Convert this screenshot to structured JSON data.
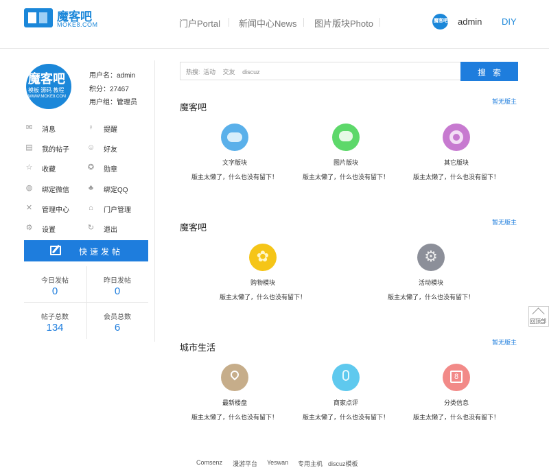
{
  "header": {
    "logo_cn": "魔客吧",
    "logo_en": "MOKE8.COM",
    "nav": [
      "门户Portal",
      "新闻中心News",
      "图片版块Photo"
    ],
    "avatar_text": "魔客吧",
    "username": "admin",
    "diy": "DIY"
  },
  "profile": {
    "avatar_title": "魔客吧",
    "avatar_sub": "模板 源码 教程",
    "avatar_url": "WWW.MOKE8.COM",
    "username_line": "用户名：admin",
    "points_line": "积分：27467",
    "group_line": "用户组：管理员"
  },
  "menu": [
    {
      "label": "消息",
      "icon": "mail-icon",
      "glyph": "✉"
    },
    {
      "label": "提醒",
      "icon": "bulb-icon",
      "glyph": "♀"
    },
    {
      "label": "我的帖子",
      "icon": "document-icon",
      "glyph": "▤"
    },
    {
      "label": "好友",
      "icon": "user-icon",
      "glyph": "☺"
    },
    {
      "label": "收藏",
      "icon": "star-icon",
      "glyph": "☆"
    },
    {
      "label": "勋章",
      "icon": "medal-icon",
      "glyph": "✪"
    },
    {
      "label": "绑定微信",
      "icon": "wechat-icon",
      "glyph": "◍"
    },
    {
      "label": "绑定QQ",
      "icon": "qq-icon",
      "glyph": "♣"
    },
    {
      "label": "管理中心",
      "icon": "tools-icon",
      "glyph": "✕"
    },
    {
      "label": "门户管理",
      "icon": "home-icon",
      "glyph": "⌂"
    },
    {
      "label": "设置",
      "icon": "gear-icon",
      "glyph": "⚙"
    },
    {
      "label": "退出",
      "icon": "logout-icon",
      "glyph": "↻"
    }
  ],
  "post_button": "快速发帖",
  "stats": [
    {
      "label": "今日发帖",
      "value": "0"
    },
    {
      "label": "昨日发帖",
      "value": "0"
    },
    {
      "label": "帖子总数",
      "value": "134"
    },
    {
      "label": "会员总数",
      "value": "6"
    }
  ],
  "search": {
    "hot_prefix": "热搜:",
    "hot_words": [
      "活动",
      "交友",
      "discuz"
    ],
    "button": "搜索"
  },
  "sections": [
    {
      "title": "魔客吧",
      "moderator": "暂无版主",
      "forums": [
        {
          "name": "文字版块",
          "desc": "版主太懒了，什么也没有留下！",
          "color": "#5ab0ea",
          "icon": "cloud-icon"
        },
        {
          "name": "图片版块",
          "desc": "版主太懒了，什么也没有留下！",
          "color": "#5dd86a",
          "icon": "chat-icon"
        },
        {
          "name": "其它版块",
          "desc": "版主太懒了，什么也没有留下！",
          "color": "#c77ad0",
          "icon": "ring-icon"
        }
      ]
    },
    {
      "title": "魔客吧",
      "moderator": "暂无版主",
      "forums": [
        {
          "name": "购物模块",
          "desc": "版主太懒了，什么也没有留下！",
          "color": "#f5c518",
          "icon": "flower-icon"
        },
        {
          "name": "活动模块",
          "desc": "版主太懒了，什么也没有留下！",
          "color": "#8c8f99",
          "icon": "gear-icon"
        }
      ]
    },
    {
      "title": "城市生活",
      "moderator": "暂无版主",
      "forums": [
        {
          "name": "最新楼盘",
          "desc": "版主太懒了，什么也没有留下！",
          "color": "#c6ad8a",
          "icon": "location-icon"
        },
        {
          "name": "商家点评",
          "desc": "版主太懒了，什么也没有留下！",
          "color": "#5fc9ee",
          "icon": "microphone-icon"
        },
        {
          "name": "分类信息",
          "desc": "版主太懒了，什么也没有留下！",
          "color": "#f28a88",
          "icon": "calendar-icon"
        }
      ]
    }
  ],
  "calendar_glyph": "8",
  "back_to_top": "回顶部",
  "footer": [
    "Comsenz",
    "漫游平台",
    "Yeswan",
    "专用主机",
    "discuz模板"
  ]
}
